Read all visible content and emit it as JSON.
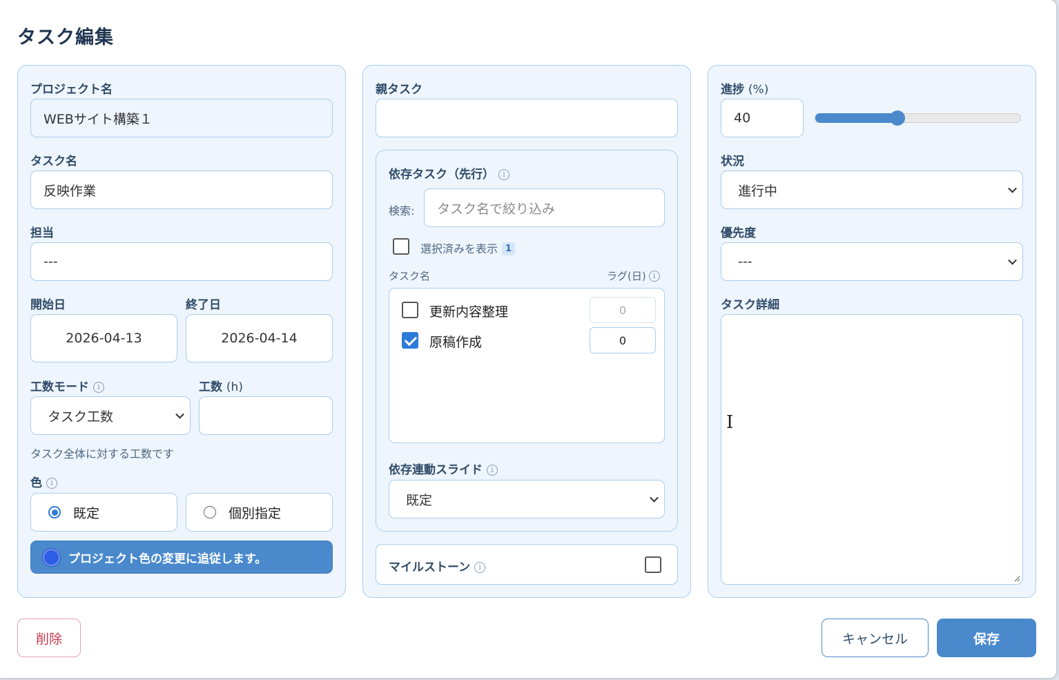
{
  "dialog": {
    "title": "タスク編集"
  },
  "left": {
    "project_label": "プロジェクト名",
    "project_value": "WEBサイト構築１",
    "task_label": "タスク名",
    "task_value": "反映作業",
    "assignee_label": "担当",
    "assignee_value": "---",
    "start_label": "開始日",
    "start_value": "2026-04-13",
    "end_label": "終了日",
    "end_value": "2026-04-14",
    "effort_mode_label": "工数モード",
    "effort_mode_value": "タスク工数",
    "effort_label": "工数",
    "effort_unit": "(h)",
    "effort_value": "",
    "effort_hint": "タスク全体に対する工数です",
    "color_label": "色",
    "color_options": [
      "既定",
      "個別指定"
    ],
    "color_selected": "既定",
    "color_note": "プロジェクト色の変更に追従します。",
    "color_swatch": "#2d5ee6"
  },
  "middle": {
    "parent_label": "親タスク",
    "parent_value": "",
    "deps_label": "依存タスク（先行）",
    "search_label": "検索:",
    "search_placeholder": "タスク名で絞り込み",
    "show_selected_label": "選択済みを表示",
    "selected_count": "1",
    "col_task": "タスク名",
    "col_lag": "ラグ(日)",
    "deps": [
      {
        "name": "更新内容整理",
        "checked": false,
        "lag": "0"
      },
      {
        "name": "原稿作成",
        "checked": true,
        "lag": "0"
      }
    ],
    "slide_label": "依存連動スライド",
    "slide_value": "既定",
    "milestone_label": "マイルストーン",
    "milestone_checked": false
  },
  "right": {
    "progress_label": "進捗",
    "progress_unit": "(%)",
    "progress_value": "40",
    "progress_fraction": 0.4,
    "status_label": "状況",
    "status_value": "進行中",
    "priority_label": "優先度",
    "priority_value": "---",
    "detail_label": "タスク詳細",
    "detail_value": ""
  },
  "footer": {
    "delete_label": "削除",
    "cancel_label": "キャンセル",
    "save_label": "保存"
  },
  "colors": {
    "accent": "#4a89cc",
    "panel_bg": "#eef5fd",
    "panel_border": "#a9cdee",
    "danger": "#c93a4d"
  }
}
